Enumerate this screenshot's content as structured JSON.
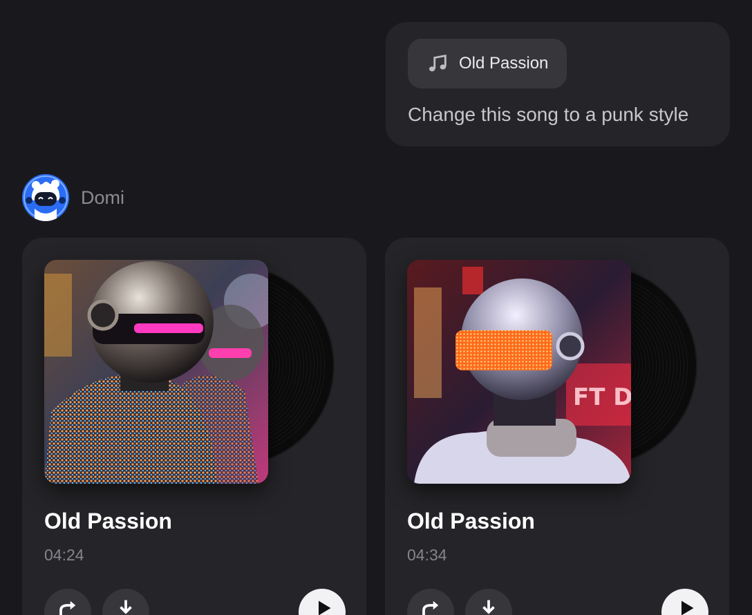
{
  "user_message": {
    "attachment": {
      "icon": "music-note-icon",
      "label": "Old Passion"
    },
    "text": "Change this song to a punk style"
  },
  "assistant": {
    "name": "Domi",
    "avatar_icon": "robot-avatar"
  },
  "songs": [
    {
      "title": "Old Passion",
      "duration": "04:24",
      "cover": "helmeted figure in sequined suit with pink visor",
      "actions": [
        "regenerate-icon",
        "download-icon",
        "play-icon"
      ]
    },
    {
      "title": "Old Passion",
      "duration": "04:34",
      "cover": "chrome helmet with orange LED visor, neon street",
      "actions": [
        "regenerate-icon",
        "download-icon",
        "play-icon"
      ]
    }
  ],
  "colors": {
    "background": "#19191d",
    "card": "#252529",
    "chip": "#36363b",
    "avatar": "#2b6cf5",
    "muted_text": "#85858b"
  }
}
